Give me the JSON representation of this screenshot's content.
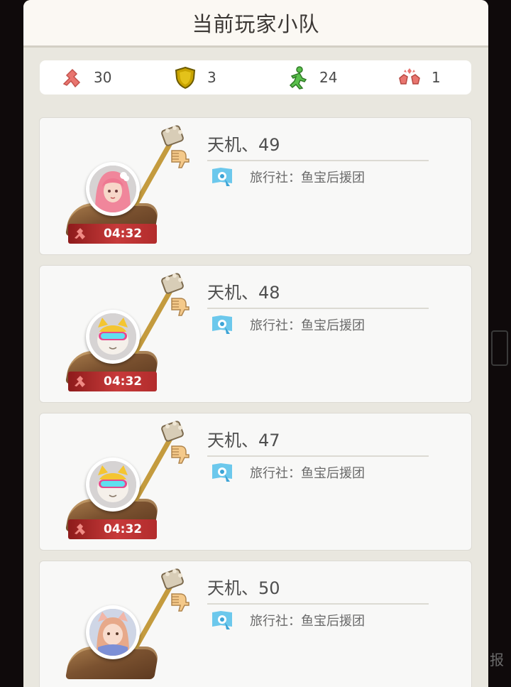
{
  "panel": {
    "title": "当前玩家小队"
  },
  "stats": [
    {
      "icon": "kill-icon",
      "value": "30",
      "color": "#e9756f"
    },
    {
      "icon": "shield-icon",
      "value": "3",
      "color": "#c9a400"
    },
    {
      "icon": "running-figure-icon",
      "value": "24",
      "color": "#59c04b"
    },
    {
      "icon": "fist-clash-icon",
      "value": "1",
      "color": "#e9756f"
    }
  ],
  "players": [
    {
      "name": "天机、49",
      "agency": "旅行社：鱼宝后援团",
      "timer": "04:32",
      "avatar": "pink-hair-girl"
    },
    {
      "name": "天机、48",
      "agency": "旅行社：鱼宝后援团",
      "timer": "04:32",
      "avatar": "cat-with-goggles"
    },
    {
      "name": "天机、47",
      "agency": "旅行社：鱼宝后援团",
      "timer": "04:32",
      "avatar": "cat-with-goggles"
    },
    {
      "name": "天机、50",
      "agency": "旅行社：鱼宝后援团",
      "timer": "",
      "avatar": "cat-ear-girl"
    }
  ],
  "background": {
    "right_edge_char": "报"
  }
}
